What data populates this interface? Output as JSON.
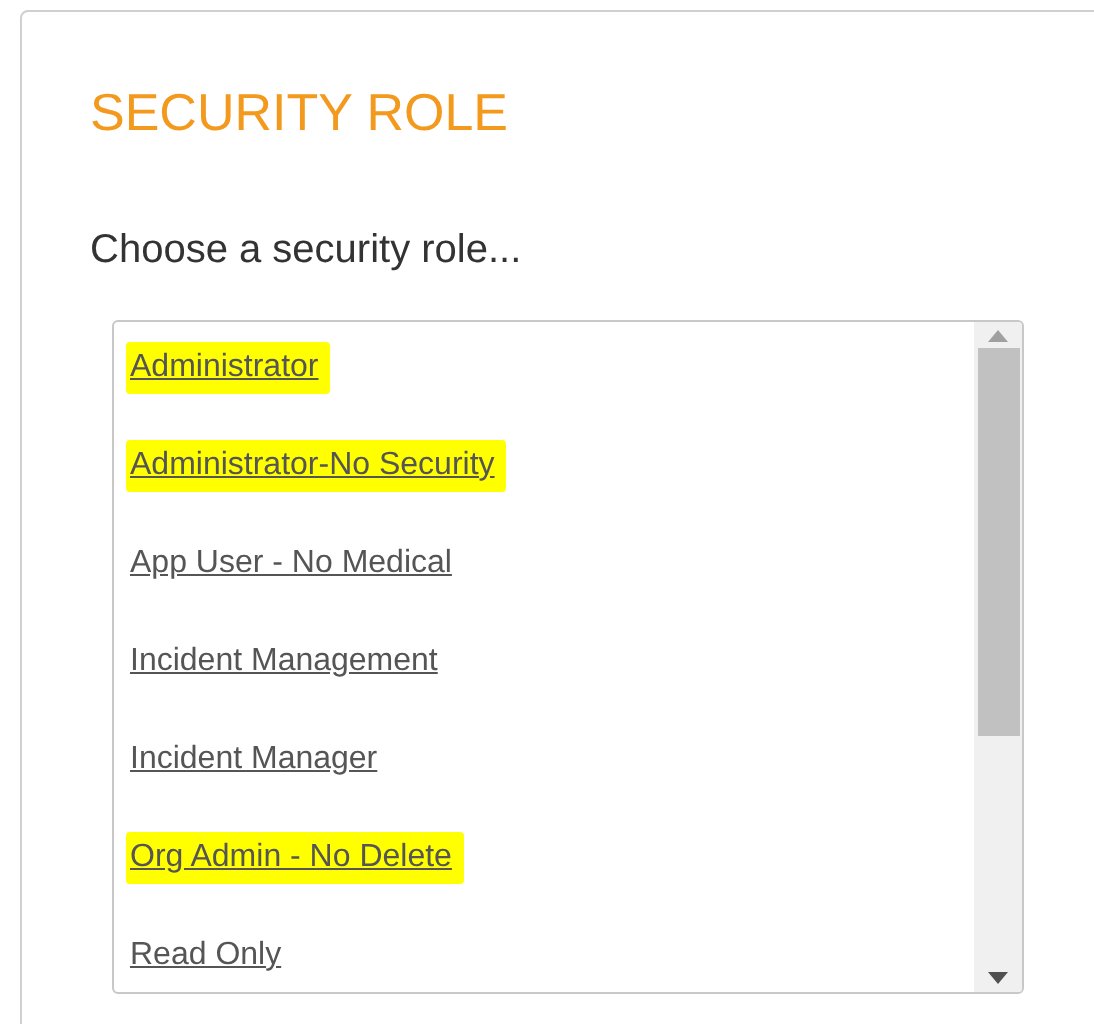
{
  "title": "SECURITY ROLE",
  "prompt": "Choose a security role...",
  "roles": [
    {
      "label": "Administrator",
      "highlighted": true
    },
    {
      "label": "Administrator-No Security",
      "highlighted": true
    },
    {
      "label": "App User - No Medical",
      "highlighted": false
    },
    {
      "label": "Incident Management",
      "highlighted": false
    },
    {
      "label": "Incident Manager",
      "highlighted": false
    },
    {
      "label": "Org Admin - No Delete",
      "highlighted": true
    },
    {
      "label": "Read Only",
      "highlighted": false
    }
  ]
}
